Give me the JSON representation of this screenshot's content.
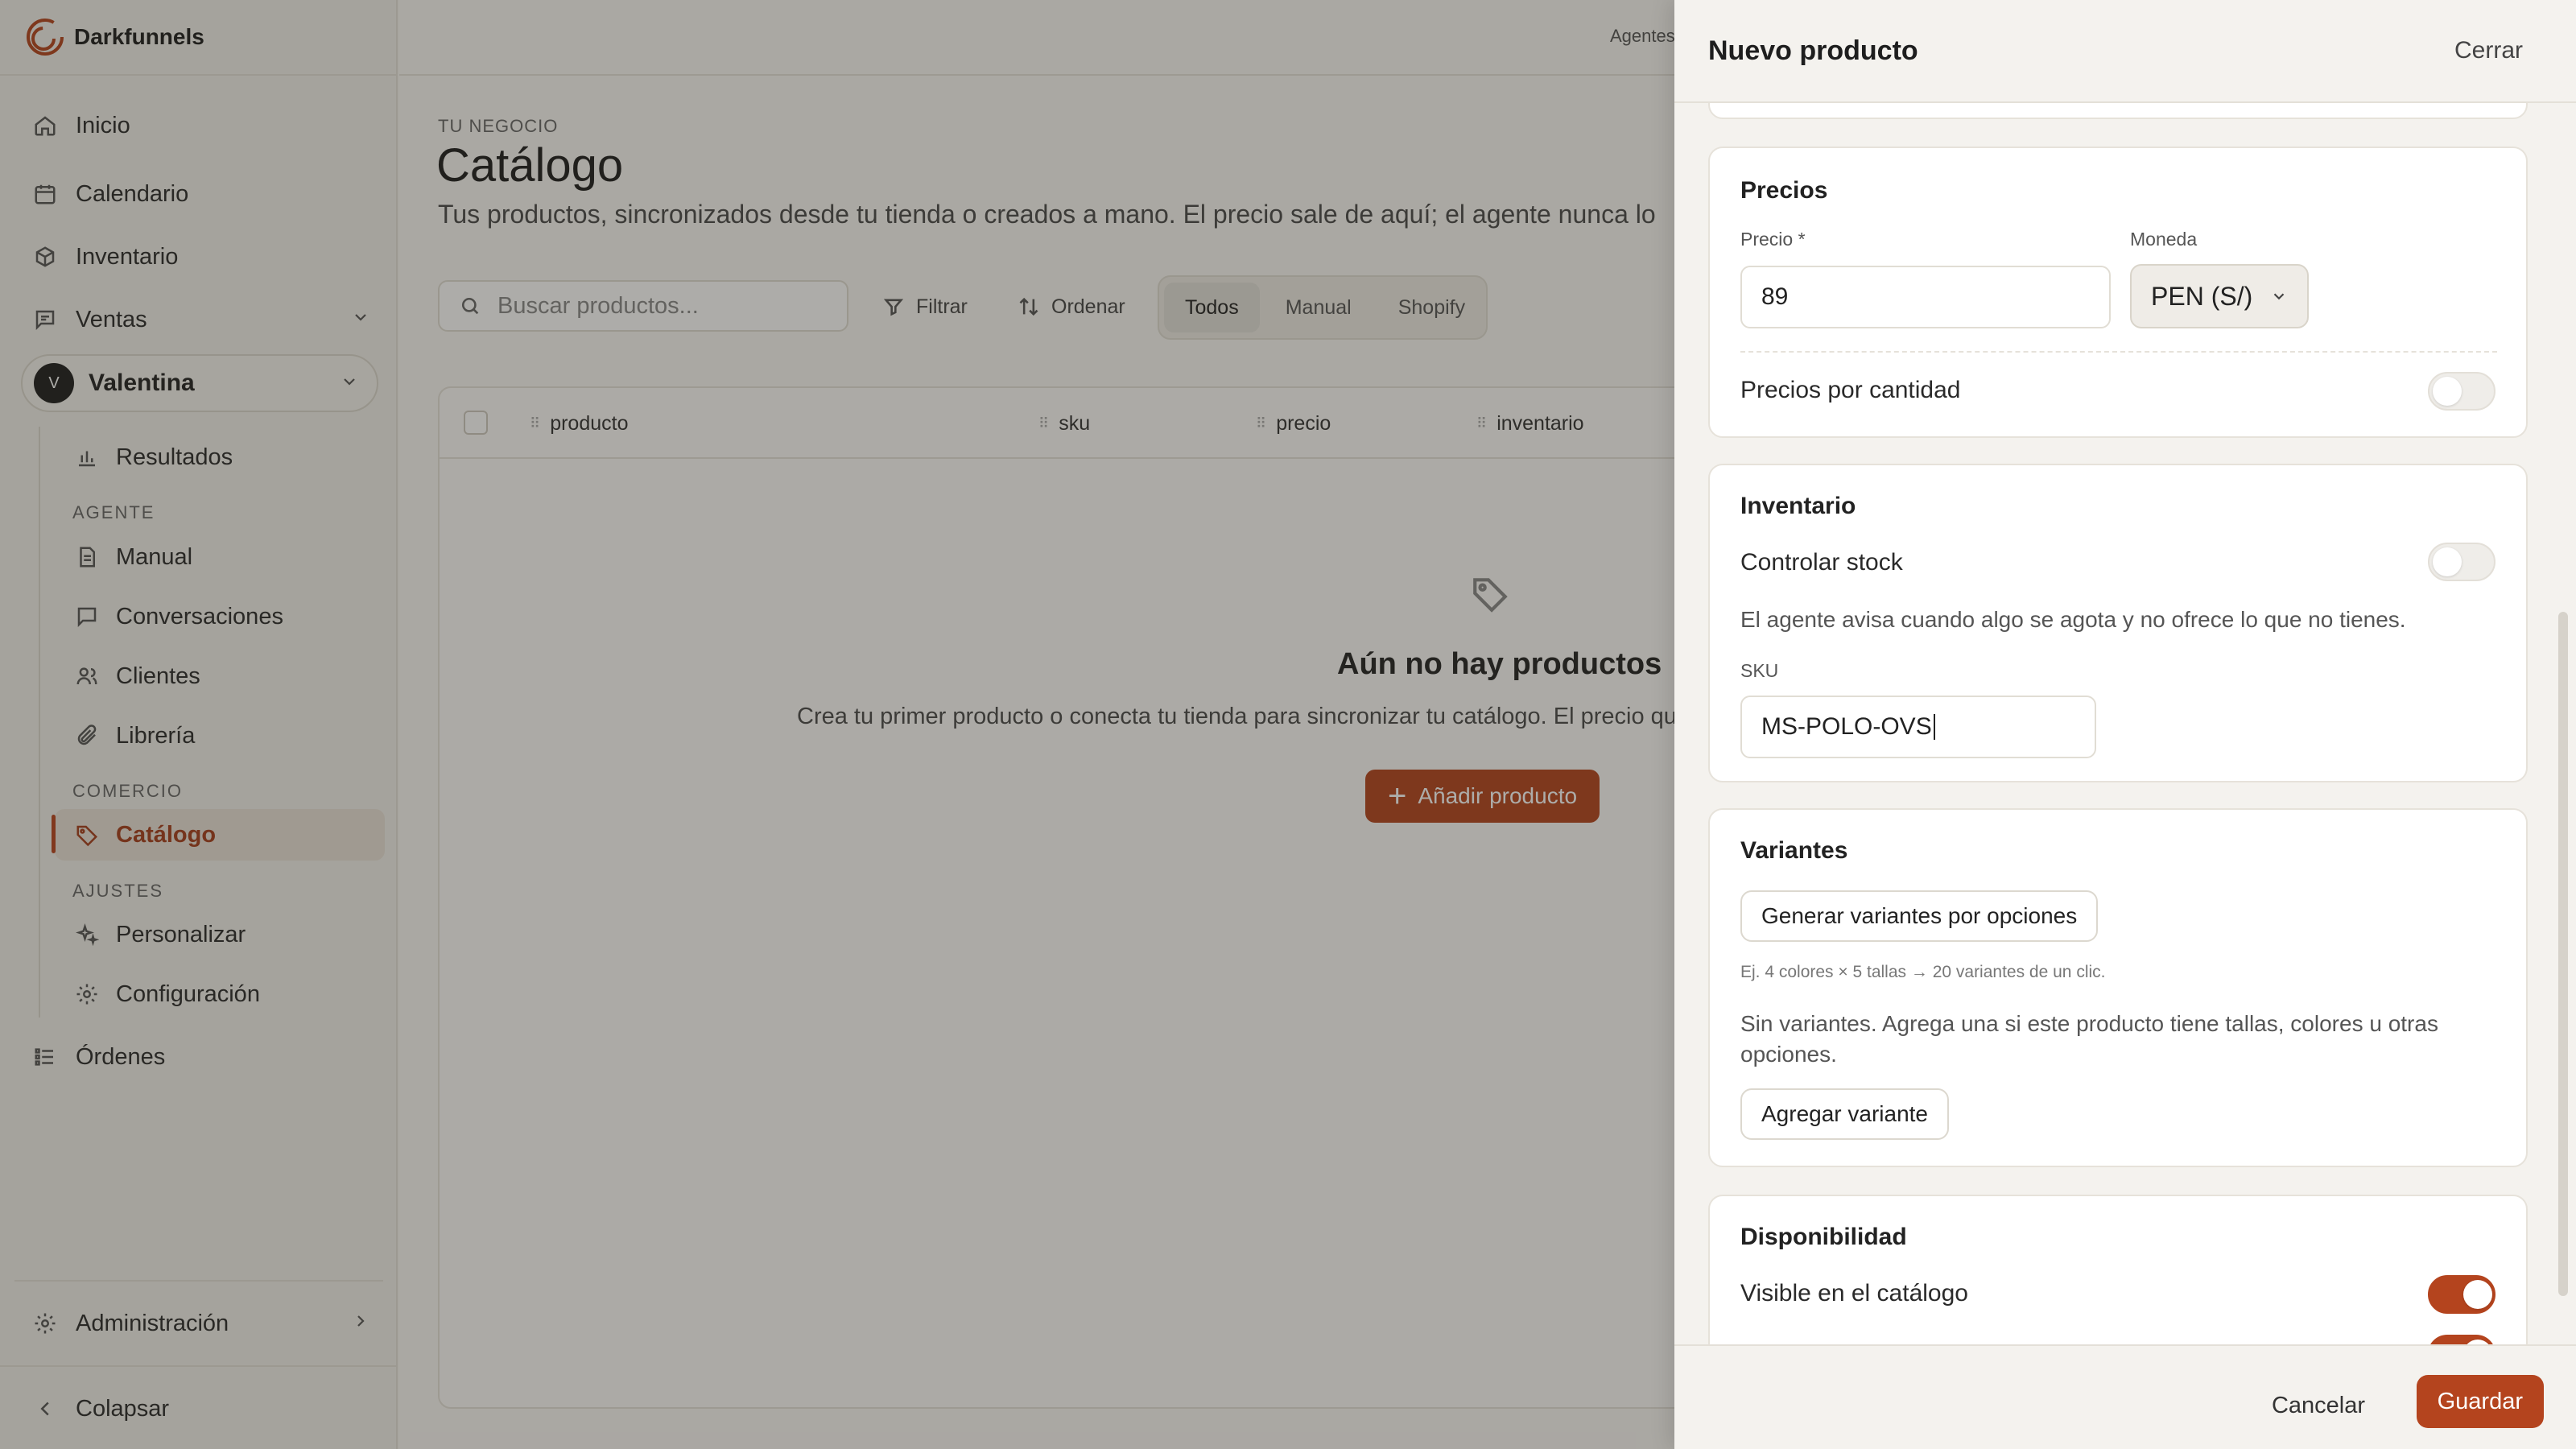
{
  "app": {
    "name": "Darkfunnels"
  },
  "sidebar": {
    "inicio": "Inicio",
    "calendario": "Calendario",
    "inventario": "Inventario",
    "ventas": "Ventas",
    "user": {
      "initial": "V",
      "name": "Valentina"
    },
    "resultados": "Resultados",
    "section_agente": "AGENTE",
    "manual": "Manual",
    "conversaciones": "Conversaciones",
    "clientes": "Clientes",
    "libreria": "Librería",
    "section_comercio": "COMERCIO",
    "catalogo": "Catálogo",
    "section_ajustes": "AJUSTES",
    "personalizar": "Personalizar",
    "configuracion": "Configuración",
    "ordenes": "Órdenes",
    "administracion": "Administración",
    "colapsar": "Colapsar"
  },
  "header": {
    "agentes": "Agentes"
  },
  "page": {
    "eyebrow": "TU NEGOCIO",
    "title": "Catálogo",
    "description": "Tus productos, sincronizados desde tu tienda o creados a mano. El precio sale de aquí; el agente nunca lo"
  },
  "toolbar": {
    "search_placeholder": "Buscar productos...",
    "filter": "Filtrar",
    "sort": "Ordenar",
    "tabs": [
      "Todos",
      "Manual",
      "Shopify"
    ]
  },
  "table": {
    "columns": [
      "producto",
      "sku",
      "precio",
      "inventario"
    ],
    "empty_title": "Aún no hay productos",
    "empty_desc": "Crea tu primer producto o conecta tu tienda para sincronizar tu catálogo. El precio que",
    "add_button": "Añadir producto"
  },
  "drawer": {
    "title": "Nuevo producto",
    "close": "Cerrar",
    "precios": {
      "title": "Precios",
      "price_label": "Precio *",
      "price_value": "89",
      "currency_label": "Moneda",
      "currency_value": "PEN (S/)",
      "bulk_label": "Precios por cantidad",
      "bulk_enabled": false
    },
    "inventario": {
      "title": "Inventario",
      "stock_label": "Controlar stock",
      "stock_enabled": false,
      "hint": "El agente avisa cuando algo se agota y no ofrece lo que no tienes.",
      "sku_label": "SKU",
      "sku_value": "MS-POLO-OVS"
    },
    "variantes": {
      "title": "Variantes",
      "generate_button": "Generar variantes por opciones",
      "example": "Ej. 4 colores × 5 tallas → 20 variantes de un clic.",
      "empty_line1": "Sin variantes. Agrega una si este producto tiene tallas, colores u otras",
      "empty_line2": "opciones.",
      "add_button": "Agregar variante"
    },
    "disponibilidad": {
      "title": "Disponibilidad",
      "visible_label": "Visible en el catálogo",
      "visible_enabled": true
    },
    "footer": {
      "cancel": "Cancelar",
      "save": "Guardar"
    }
  },
  "colors": {
    "accent": "#b4441e",
    "active_bg": "#ebe3d8"
  }
}
